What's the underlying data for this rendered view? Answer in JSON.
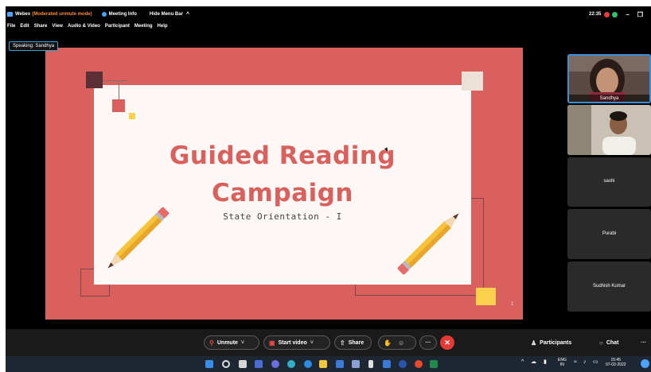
{
  "titlebar": {
    "app_name": "Webex",
    "mode": "(Moderated unmute mode)",
    "meeting_info": "Meeting Info",
    "hide_menu": "Hide Menu Bar",
    "caret": "^",
    "clock": "22:35",
    "minimize": "–",
    "restore": "❒"
  },
  "menu": [
    "File",
    "Edit",
    "Share",
    "View",
    "Audio & Video",
    "Participant",
    "Meeting",
    "Help"
  ],
  "speaking_badge": "Speaking: Sandhya",
  "slide": {
    "title_line1": "Guided Reading",
    "title_line2": "Campaign",
    "subtitle": "State Orientation - I",
    "page_number": "1",
    "colors": {
      "background": "#d9605c",
      "card": "#fdf8f6",
      "title": "#d9605c",
      "accent_yellow": "#f9d14a"
    }
  },
  "participants": [
    {
      "name": "Sandhya",
      "has_video": true,
      "active_speaker": true
    },
    {
      "name": "",
      "has_video": true,
      "active_speaker": false
    },
    {
      "name": "sashi",
      "has_video": false
    },
    {
      "name": "Purabi",
      "has_video": false
    },
    {
      "name": "Sudhish Kumar",
      "has_video": false
    }
  ],
  "toolbar": {
    "unmute_label": "Unmute",
    "start_video_label": "Start video",
    "share_label": "Share",
    "more_label": "···",
    "end_label": "✕",
    "participants_label": "Participants",
    "chat_label": "Chat",
    "overflow": "···"
  },
  "taskbar": {
    "lang_line1": "ENG",
    "lang_line2": "IN",
    "time": "15:45",
    "date": "07-03-2022"
  }
}
